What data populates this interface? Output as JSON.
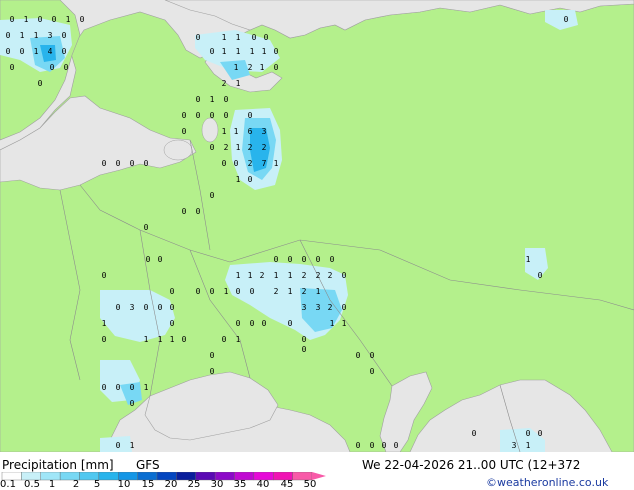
{
  "legend": {
    "title": "Precipitation [mm]",
    "model": "GFS",
    "colors": [
      "#fefefe",
      "#c8f0f8",
      "#a0e6f8",
      "#78d8f4",
      "#50c8f0",
      "#28b4ec",
      "#1496e6",
      "#0a6ed2",
      "#0446c0",
      "#0a1e9c",
      "#5a0ab4",
      "#8c0ac8",
      "#c00ad2",
      "#e60ad8",
      "#f014b4",
      "#f85aa8"
    ],
    "ticks": [
      "0.1",
      "0.5",
      "1",
      "2",
      "5",
      "10",
      "15",
      "20",
      "25",
      "30",
      "35",
      "40",
      "45",
      "50"
    ]
  },
  "header": {
    "datetime": "We 22-04-2026 21..00 UTC (12+372",
    "credit": "©weatheronline.co.uk"
  },
  "map_palette": {
    "land": "#b4f08c",
    "sea": "#e6e6e6",
    "light_precip": "#c8f0f8",
    "medium_precip": "#78d8f4",
    "heavy_precip": "#28b4ec"
  },
  "station_values": [
    {
      "text": "0"
    },
    {
      "text": "1"
    },
    {
      "text": "0"
    },
    {
      "text": "0"
    },
    {
      "text": "1"
    },
    {
      "text": "0"
    },
    {
      "text": "0"
    },
    {
      "text": "1"
    },
    {
      "text": "1"
    },
    {
      "text": "3"
    },
    {
      "text": "0"
    },
    {
      "text": "0"
    },
    {
      "text": "0"
    },
    {
      "text": "1"
    },
    {
      "text": "4"
    },
    {
      "text": "0"
    },
    {
      "text": "0"
    },
    {
      "text": "0"
    },
    {
      "text": "0"
    },
    {
      "text": "0"
    },
    {
      "text": "0"
    },
    {
      "text": "1"
    },
    {
      "text": "1"
    },
    {
      "text": "0"
    },
    {
      "text": "0"
    },
    {
      "text": "0"
    },
    {
      "text": "1"
    },
    {
      "text": "1"
    },
    {
      "text": "1"
    },
    {
      "text": "1"
    },
    {
      "text": "0"
    },
    {
      "text": "1"
    },
    {
      "text": "2"
    },
    {
      "text": "1"
    },
    {
      "text": "0"
    },
    {
      "text": "2"
    },
    {
      "text": "1"
    },
    {
      "text": "0"
    },
    {
      "text": "1"
    },
    {
      "text": "0"
    },
    {
      "text": "0"
    },
    {
      "text": "0"
    },
    {
      "text": "0"
    },
    {
      "text": "0"
    },
    {
      "text": "0"
    },
    {
      "text": "0"
    },
    {
      "text": "1"
    },
    {
      "text": "1"
    },
    {
      "text": "6"
    },
    {
      "text": "3"
    },
    {
      "text": "0"
    },
    {
      "text": "2"
    },
    {
      "text": "1"
    },
    {
      "text": "2"
    },
    {
      "text": "2"
    },
    {
      "text": "0"
    },
    {
      "text": "0"
    },
    {
      "text": "2"
    },
    {
      "text": "7"
    },
    {
      "text": "1"
    },
    {
      "text": "1"
    },
    {
      "text": "0"
    },
    {
      "text": "0"
    },
    {
      "text": "0"
    },
    {
      "text": "0"
    },
    {
      "text": "0"
    },
    {
      "text": "0"
    },
    {
      "text": "0"
    },
    {
      "text": "0"
    },
    {
      "text": "0"
    },
    {
      "text": "0"
    },
    {
      "text": "0"
    },
    {
      "text": "0"
    },
    {
      "text": "0"
    },
    {
      "text": "0"
    },
    {
      "text": "0"
    },
    {
      "text": "0"
    },
    {
      "text": "0"
    },
    {
      "text": "1"
    },
    {
      "text": "1"
    },
    {
      "text": "2"
    },
    {
      "text": "1"
    },
    {
      "text": "1"
    },
    {
      "text": "2"
    },
    {
      "text": "2"
    },
    {
      "text": "2"
    },
    {
      "text": "0"
    },
    {
      "text": "0"
    },
    {
      "text": "0"
    },
    {
      "text": "0"
    },
    {
      "text": "1"
    },
    {
      "text": "0"
    },
    {
      "text": "0"
    },
    {
      "text": "2"
    },
    {
      "text": "1"
    },
    {
      "text": "2"
    },
    {
      "text": "1"
    },
    {
      "text": "0"
    },
    {
      "text": "3"
    },
    {
      "text": "0"
    },
    {
      "text": "0"
    },
    {
      "text": "0"
    },
    {
      "text": "3"
    },
    {
      "text": "3"
    },
    {
      "text": "2"
    },
    {
      "text": "0"
    },
    {
      "text": "1"
    },
    {
      "text": "0"
    },
    {
      "text": "0"
    },
    {
      "text": "0"
    },
    {
      "text": "0"
    },
    {
      "text": "0"
    },
    {
      "text": "1"
    },
    {
      "text": "1"
    },
    {
      "text": "0"
    },
    {
      "text": "1"
    },
    {
      "text": "1"
    },
    {
      "text": "1"
    },
    {
      "text": "0"
    },
    {
      "text": "0"
    },
    {
      "text": "1"
    },
    {
      "text": "0"
    },
    {
      "text": "0"
    },
    {
      "text": "0"
    },
    {
      "text": "0"
    },
    {
      "text": "0"
    },
    {
      "text": "0"
    },
    {
      "text": "0"
    },
    {
      "text": "0"
    },
    {
      "text": "1"
    },
    {
      "text": "0"
    },
    {
      "text": "0"
    },
    {
      "text": "0"
    },
    {
      "text": "1"
    },
    {
      "text": "0"
    },
    {
      "text": "0"
    },
    {
      "text": "0"
    },
    {
      "text": "0"
    },
    {
      "text": "0"
    },
    {
      "text": "3"
    },
    {
      "text": "1"
    },
    {
      "text": "0"
    },
    {
      "text": "0"
    },
    {
      "text": "0"
    },
    {
      "text": "0"
    },
    {
      "text": "0"
    },
    {
      "text": "1"
    }
  ]
}
